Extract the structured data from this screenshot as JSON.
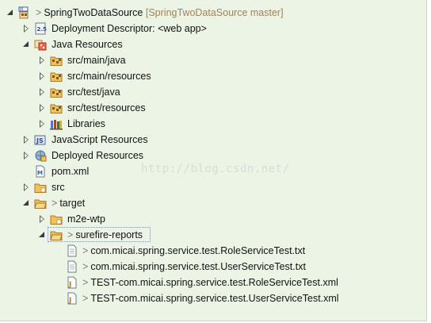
{
  "watermark": "http://blog.csdn.net/",
  "tree": {
    "project_name": "SpringTwoDataSource",
    "project_decoration": "[SpringTwoDataSource master]",
    "git_marker": ">",
    "deployment_descriptor": "Deployment Descriptor: <web app>",
    "java_resources": "Java Resources",
    "src_main_java": "src/main/java",
    "src_main_resources": "src/main/resources",
    "src_test_java": "src/test/java",
    "src_test_resources": "src/test/resources",
    "libraries": "Libraries",
    "javascript_resources": "JavaScript Resources",
    "deployed_resources": "Deployed Resources",
    "pom": "pom.xml",
    "src": "src",
    "target": "target",
    "m2e_wtp": "m2e-wtp",
    "surefire_reports": "surefire-reports",
    "files": [
      "com.micai.spring.service.test.RoleServiceTest.txt",
      "com.micai.spring.service.test.UserServiceTest.txt",
      "TEST-com.micai.spring.service.test.RoleServiceTest.xml",
      "TEST-com.micai.spring.service.test.UserServiceTest.xml"
    ]
  },
  "icons": {
    "project": "maven-web-project-icon",
    "descriptor": "deployment-descriptor-icon",
    "java_resources": "java-resources-icon",
    "source_folder": "package-folder-icon",
    "libraries": "libraries-icon",
    "javascript": "javascript-resources-icon",
    "deployed": "deployed-resources-icon",
    "pom": "xml-file-icon",
    "folder": "folder-icon",
    "txt": "text-file-icon",
    "xml": "xml-file-icon"
  },
  "colors": {
    "background": "#ecf5e5",
    "decoration": "#a08255",
    "folder": "#e8b94a"
  }
}
